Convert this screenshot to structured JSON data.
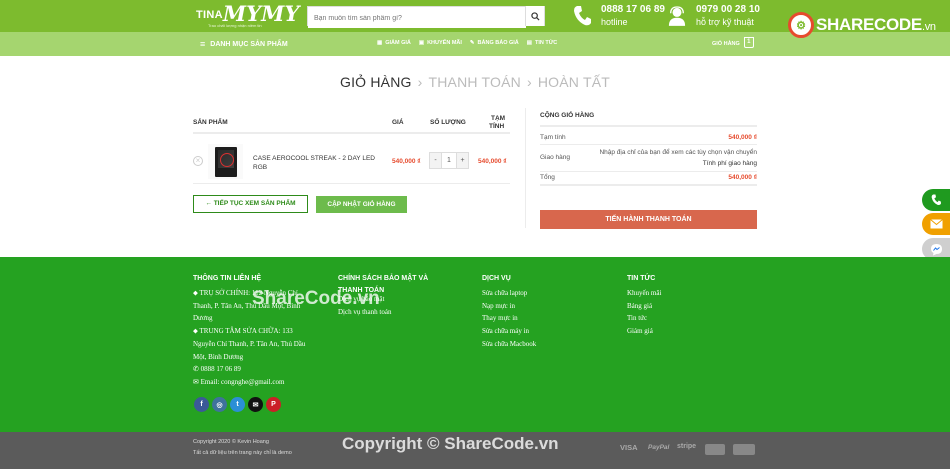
{
  "header": {
    "logo": {
      "part1": "TINA",
      "part2": "MYMY",
      "slogan": "Trao chất lượng nhận niềm tin"
    },
    "search_placeholder": "Bạn muốn tìm sản phẩm gì?",
    "contacts": [
      {
        "number": "0888 17 06 89",
        "label": "hotline"
      },
      {
        "number": "0979 00 28 10",
        "label": "hỗ trợ kỹ thuật"
      }
    ]
  },
  "nav": {
    "category_menu": "DANH MỤC SẢN PHẨM",
    "links": [
      "GIẢM GIÁ",
      "KHUYẾN MÃI",
      "BẢNG BÁO GIÁ",
      "TIN TỨC"
    ],
    "cart_label": "GIỎ HÀNG",
    "cart_count": "1"
  },
  "watermark": {
    "brand": "SHARECODE",
    "brand_tld": ".vn",
    "mid": "ShareCode.vn",
    "copyright": "Copyright © ShareCode.vn"
  },
  "steps": {
    "cart": "GIỎ HÀNG",
    "checkout": "THANH TOÁN",
    "done": "HOÀN TẤT"
  },
  "cart_table": {
    "headers": {
      "product": "SẢN PHẨM",
      "price": "GIÁ",
      "qty": "SỐ LƯỢNG",
      "subtotal_1": "TẠM",
      "subtotal_2": "TÍNH"
    },
    "items": [
      {
        "name": "CASE AEROCOOL STREAK - 2 DAY LED RGB",
        "price": "540,000 ₫",
        "qty": "1",
        "subtotal": "540,000 ₫"
      }
    ],
    "continue_label": "← TIẾP TỤC XEM SẢN PHẨM",
    "update_label": "CẬP NHẬT GIỎ HÀNG"
  },
  "totals": {
    "title": "CỘNG GIỎ HÀNG",
    "subtotal_label": "Tạm tính",
    "subtotal_value": "540,000 ₫",
    "shipping_label": "Giao hàng",
    "shipping_note": "Nhập địa chỉ của bạn để xem các tùy chọn vận chuyển",
    "shipping_calc": "Tính phí giao hàng",
    "total_label": "Tổng",
    "total_value": "540,000 ₫",
    "checkout_label": "TIẾN HÀNH THANH TOÁN"
  },
  "footer": {
    "contact": {
      "title": "THÔNG TIN LIÊN HỆ",
      "lines": [
        "TRỤ SỞ CHÍNH: 112 Nguyễn Chí",
        "Thanh, P. Tân An, Thủ Dầu Một, Bình",
        "Dương",
        "TRUNG TÂM SỬA CHỮA: 133",
        "Nguyễn Chí Thanh, P. Tân An, Thủ Dầu",
        "Một, Bình Dương",
        "0888 17 06 89",
        "Email: congnghe@gmail.com"
      ]
    },
    "policy": {
      "title_1": "CHÍNH SÁCH BẢO MẬT VÀ",
      "title_2": "THANH TOÁN",
      "items": [
        "Dịch vụ bảo mật",
        "Dịch vụ thanh toán"
      ]
    },
    "services": {
      "title": "DỊCH VỤ",
      "items": [
        "Sửa chữa laptop",
        "Nạp mực in",
        "Thay mực in",
        "Sửa chữa máy in",
        "Sửa chữa Macbook"
      ]
    },
    "news": {
      "title": "TIN TỨC",
      "items": [
        "Khuyến mãi",
        "Bảng giá",
        "Tin tức",
        "Giảm giá"
      ]
    },
    "copyright": "Copyright 2020 © Kevin Hoang",
    "note": "Tất cả dữ liệu trên trang này chỉ là demo",
    "payments": [
      "VISA",
      "PayPal",
      "stripe",
      "",
      ""
    ]
  },
  "colors": {
    "green": "#25a221",
    "lime": "#7dbb2e",
    "accent": "#e64b2e"
  }
}
